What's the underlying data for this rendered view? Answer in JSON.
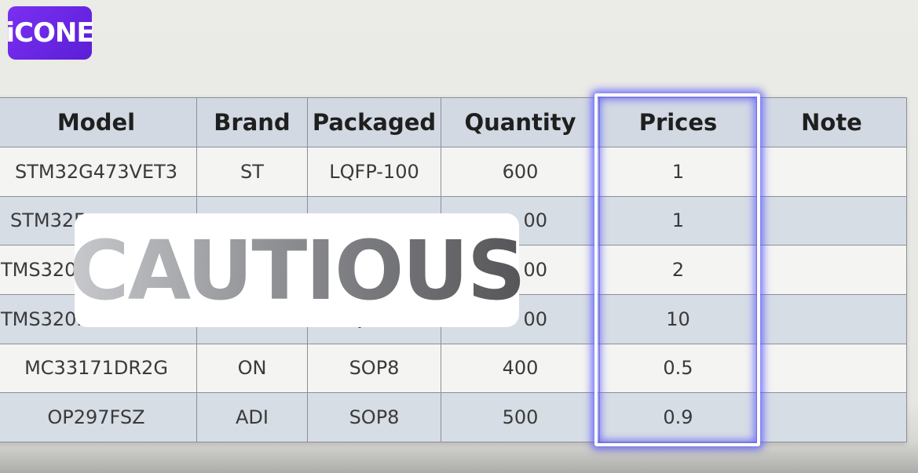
{
  "logo": {
    "text": "iCONE",
    "bg": "#6a27e6"
  },
  "table": {
    "headers": {
      "model": "Model",
      "brand": "Brand",
      "packaged": "Packaged",
      "quantity": "Quantity",
      "prices": "Prices",
      "note": "Note"
    },
    "rows": [
      {
        "model": "STM32G473VET3",
        "brand": "ST",
        "packaged": "LQFP-100",
        "quantity": "600",
        "prices": "1",
        "note": ""
      },
      {
        "model": "STM32F",
        "brand": "",
        "packaged": "",
        "quantity": "00",
        "prices": "1",
        "note": ""
      },
      {
        "model": "TMS320I",
        "brand": "",
        "packaged": "",
        "quantity": "00",
        "prices": "2",
        "note": ""
      },
      {
        "model": "TMS320F",
        "brand": "",
        "packaged": "Q",
        "quantity": "00",
        "prices": "10",
        "note": ""
      },
      {
        "model": "MC33171DR2G",
        "brand": "ON",
        "packaged": "SOP8",
        "quantity": "400",
        "prices": "0.5",
        "note": ""
      },
      {
        "model": "OP297FSZ",
        "brand": "ADI",
        "packaged": "SOP8",
        "quantity": "500",
        "prices": "0.9",
        "note": ""
      }
    ]
  },
  "overlay": {
    "caution_text": "CAUTIOUS"
  },
  "colors": {
    "header_bg": "#d3d9e2",
    "highlight_glow": "#5a5aff"
  }
}
